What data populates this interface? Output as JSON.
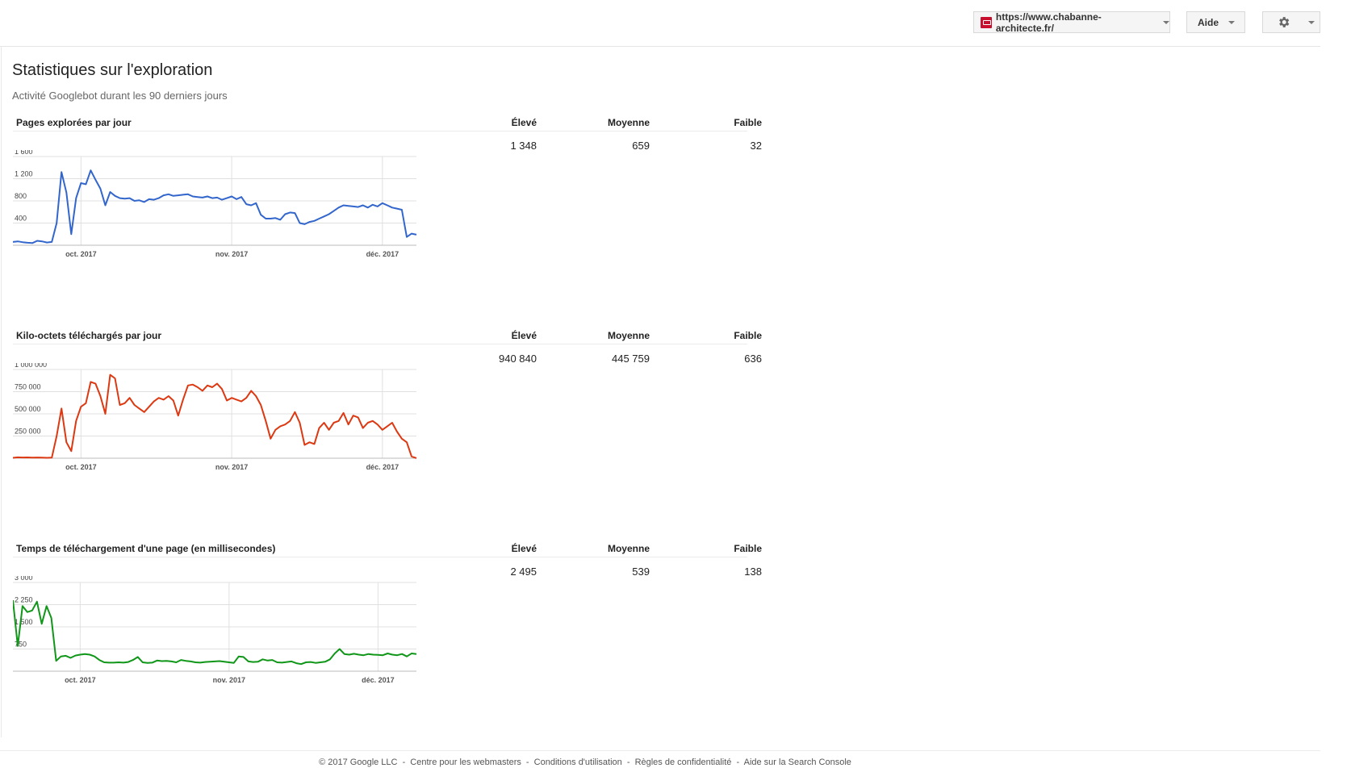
{
  "header": {
    "site_url": "https://www.chabanne-architecte.fr/",
    "help_label": "Aide",
    "settings_icon": "gear-icon"
  },
  "page": {
    "title": "Statistiques sur l'exploration",
    "subtitle": "Activité Googlebot durant les 90 derniers jours"
  },
  "columns": {
    "high": "Élevé",
    "average": "Moyenne",
    "low": "Faible"
  },
  "sections": [
    {
      "metric": "Pages explorées par jour",
      "high": "1 348",
      "average": "659",
      "low": "32"
    },
    {
      "metric": "Kilo-octets téléchargés par jour",
      "high": "940 840",
      "average": "445 759",
      "low": "636"
    },
    {
      "metric": "Temps de téléchargement d'une page (en millisecondes)",
      "high": "2 495",
      "average": "539",
      "low": "138"
    }
  ],
  "footer": {
    "copyright": "© 2017 Google LLC",
    "links": [
      "Centre pour les webmasters",
      "Conditions d'utilisation",
      "Règles de confidentialité",
      "Aide sur la Search Console"
    ]
  },
  "chart_data": [
    {
      "type": "line",
      "title": "Pages explorées par jour",
      "color": "#3366cc",
      "x_ticks": [
        "oct. 2017",
        "nov. 2017",
        "déc. 2017"
      ],
      "x_tick_days": [
        14,
        45,
        76
      ],
      "ylim": [
        0,
        1600
      ],
      "y_ticks": [
        400,
        800,
        1200,
        1600
      ],
      "y_tick_labels": [
        "400",
        "800",
        "1 200",
        "1 600"
      ],
      "x_start": "2017-09-17",
      "values": [
        60,
        70,
        55,
        45,
        40,
        80,
        70,
        50,
        60,
        400,
        1320,
        950,
        200,
        850,
        1120,
        1100,
        1350,
        1180,
        1020,
        720,
        960,
        890,
        850,
        840,
        850,
        800,
        810,
        780,
        830,
        820,
        850,
        900,
        920,
        890,
        900,
        910,
        920,
        880,
        870,
        860,
        880,
        850,
        860,
        820,
        850,
        880,
        830,
        870,
        740,
        720,
        760,
        550,
        480,
        480,
        490,
        460,
        560,
        590,
        580,
        400,
        380,
        420,
        440,
        480,
        520,
        560,
        620,
        680,
        720,
        710,
        700,
        690,
        720,
        680,
        730,
        700,
        760,
        720,
        680,
        660,
        640,
        150,
        210,
        190
      ]
    },
    {
      "type": "line",
      "title": "Kilo-octets téléchargés par jour",
      "color": "#dc3912",
      "x_ticks": [
        "oct. 2017",
        "nov. 2017",
        "déc. 2017"
      ],
      "x_tick_days": [
        14,
        45,
        76
      ],
      "ylim": [
        0,
        1000000
      ],
      "y_ticks": [
        250000,
        500000,
        750000,
        1000000
      ],
      "y_tick_labels": [
        "250 000",
        "500 000",
        "750 000",
        "1 000 000"
      ],
      "x_start": "2017-09-17",
      "values": [
        5000,
        10000,
        8000,
        9000,
        6000,
        8000,
        7000,
        5000,
        6000,
        250000,
        560000,
        180000,
        80000,
        420000,
        580000,
        620000,
        860000,
        840000,
        700000,
        500000,
        940000,
        900000,
        600000,
        620000,
        680000,
        600000,
        560000,
        520000,
        580000,
        640000,
        680000,
        660000,
        700000,
        650000,
        480000,
        660000,
        820000,
        830000,
        800000,
        760000,
        820000,
        800000,
        840000,
        780000,
        650000,
        680000,
        660000,
        640000,
        680000,
        760000,
        700000,
        600000,
        420000,
        220000,
        320000,
        360000,
        380000,
        420000,
        520000,
        400000,
        150000,
        180000,
        160000,
        340000,
        400000,
        320000,
        400000,
        420000,
        510000,
        380000,
        480000,
        460000,
        340000,
        400000,
        420000,
        380000,
        320000,
        360000,
        400000,
        300000,
        220000,
        180000,
        20000,
        636
      ]
    },
    {
      "type": "line",
      "title": "Temps de téléchargement d'une page (en millisecondes)",
      "color": "#109618",
      "x_ticks": [
        "oct. 2017",
        "nov. 2017",
        "déc. 2017"
      ],
      "x_tick_days": [
        14,
        45,
        76
      ],
      "ylim": [
        0,
        3000
      ],
      "y_ticks": [
        750,
        1500,
        2250,
        3000
      ],
      "y_tick_labels": [
        "750",
        "1 500",
        "2 250",
        "3 000"
      ],
      "x_start": "2017-09-17",
      "values": [
        2400,
        850,
        2200,
        2000,
        2050,
        2350,
        1600,
        2200,
        1800,
        350,
        500,
        520,
        450,
        530,
        560,
        580,
        560,
        500,
        380,
        300,
        290,
        290,
        300,
        290,
        310,
        380,
        480,
        300,
        280,
        290,
        360,
        340,
        350,
        330,
        300,
        380,
        350,
        330,
        300,
        290,
        310,
        320,
        330,
        340,
        320,
        300,
        280,
        500,
        480,
        330,
        310,
        320,
        400,
        360,
        380,
        300,
        290,
        310,
        330,
        270,
        240,
        300,
        310,
        280,
        300,
        320,
        400,
        600,
        750,
        580,
        560,
        590,
        560,
        540,
        580,
        560,
        550,
        540,
        600,
        560,
        540,
        580,
        500,
        600,
        580
      ]
    }
  ]
}
